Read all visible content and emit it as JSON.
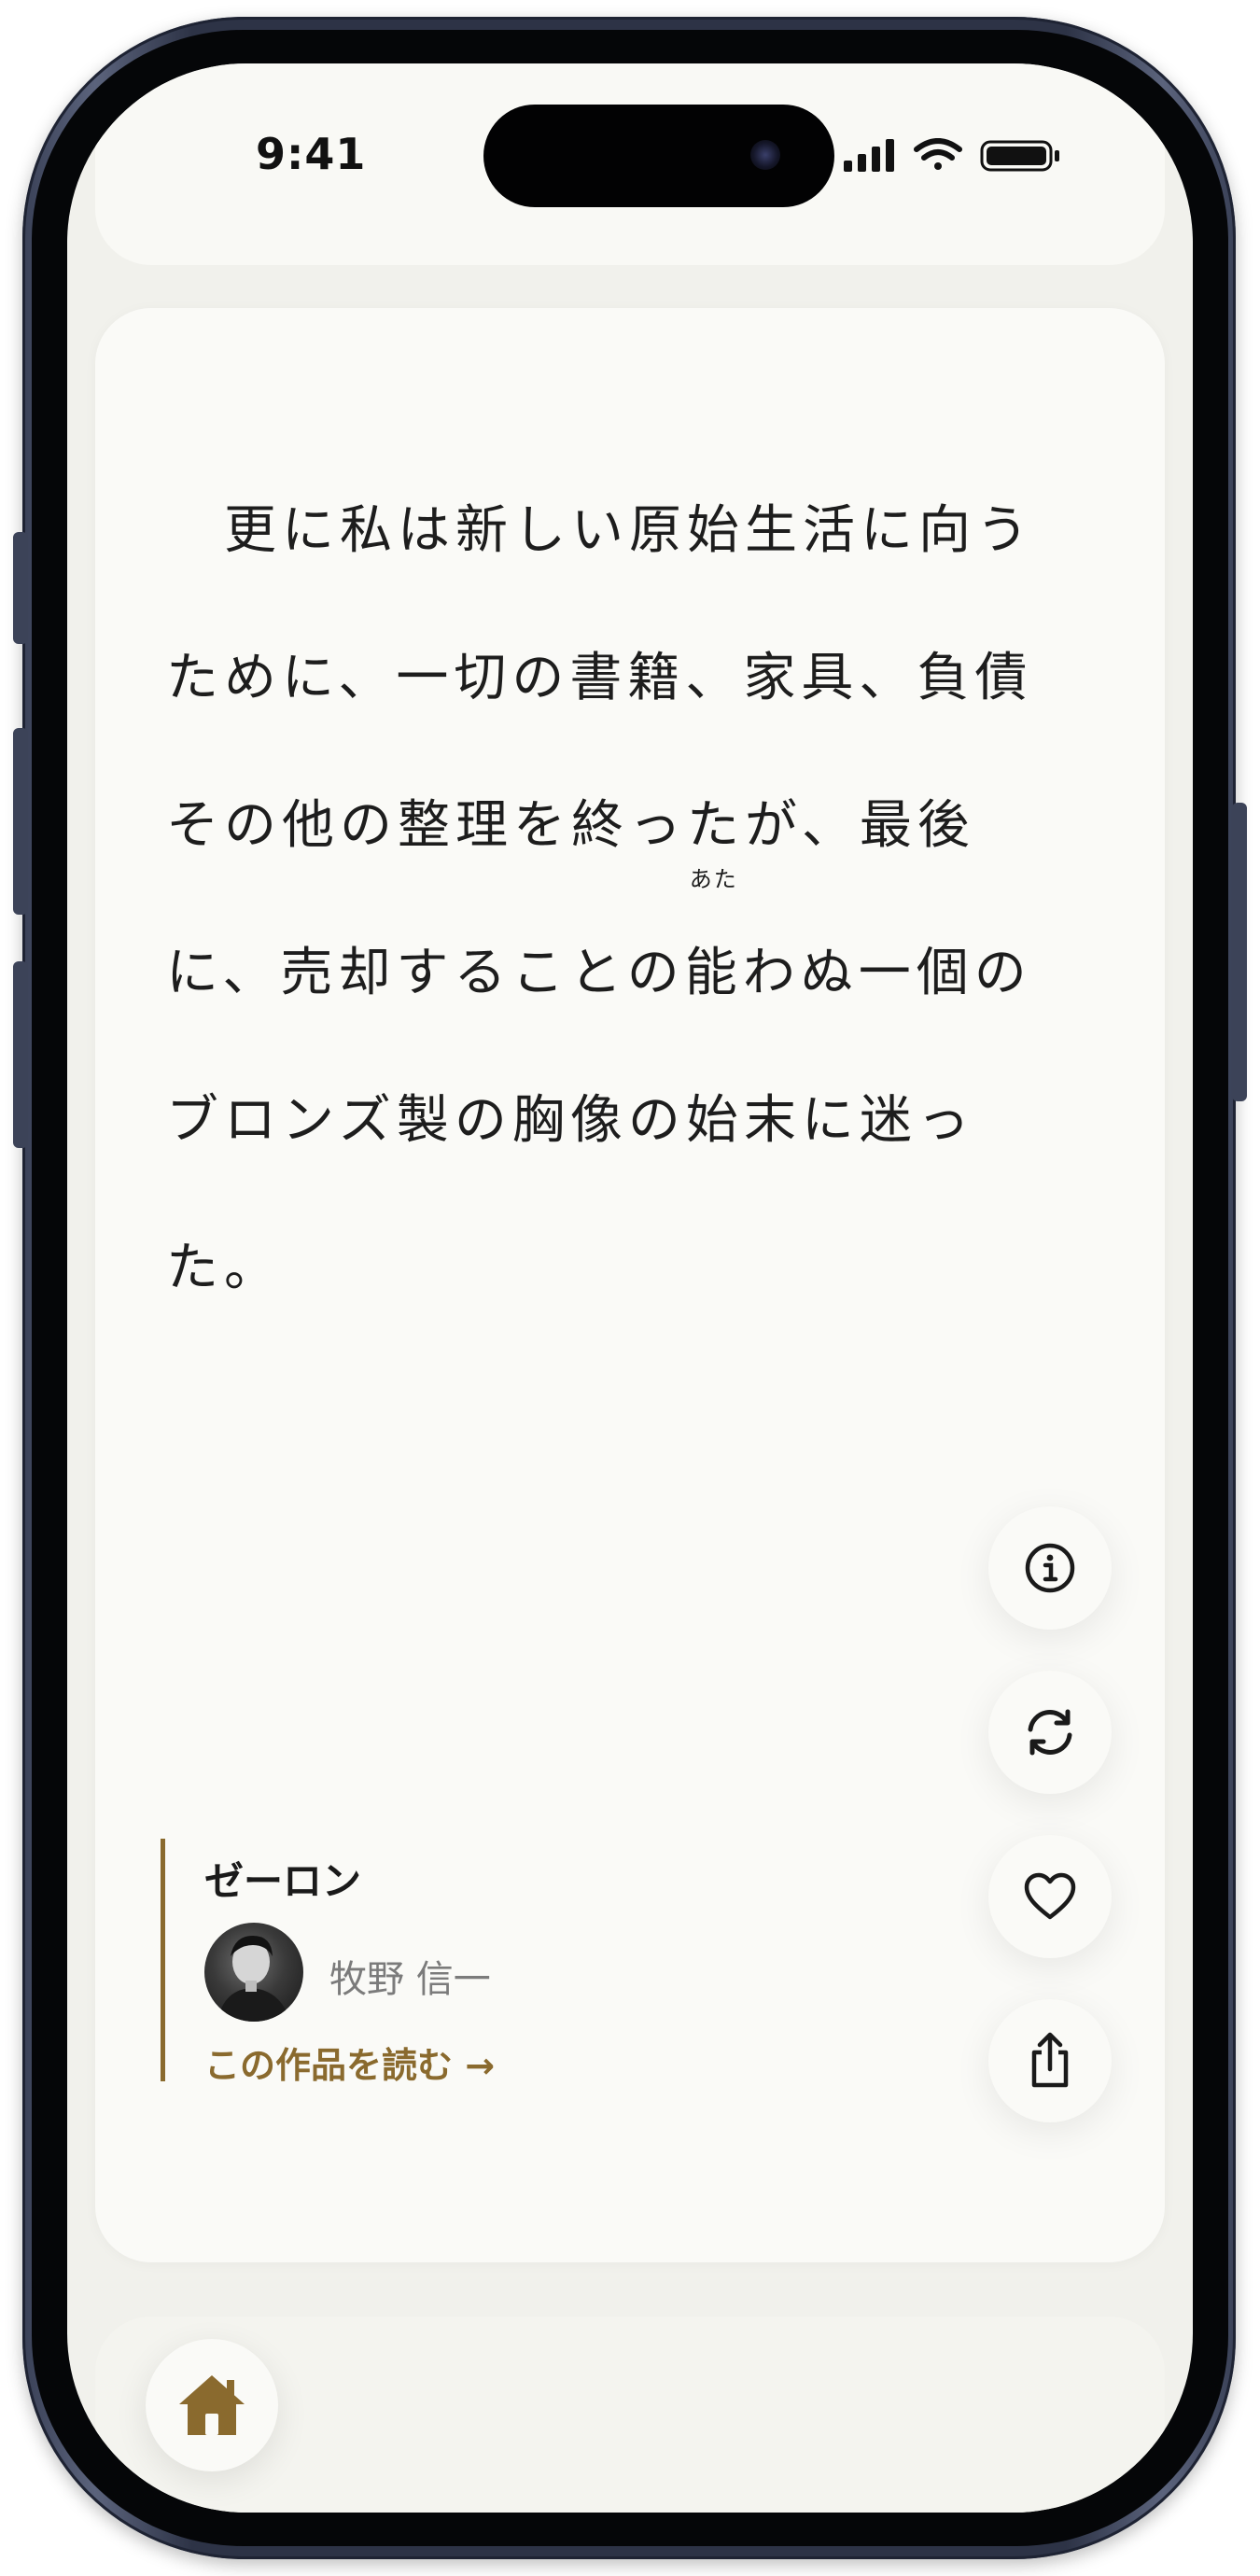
{
  "status_bar": {
    "time": "9:41"
  },
  "quote": {
    "lines": [
      "　更に私は新しい原始生活に向う",
      "ために、一切の書籍、家具、負債",
      "その他の整理を終ったが、最後",
      "に、売却することの",
      "わぬ一個の",
      "ブロンズ製の胸像の始末に迷っ",
      "た。"
    ],
    "ruby_base": "能",
    "ruby_text": "あた"
  },
  "actions": {
    "info": "info-icon",
    "refresh": "refresh-icon",
    "favorite": "heart-icon",
    "share": "share-icon"
  },
  "attribution": {
    "work_title": "ゼーロン",
    "author": "牧野 信一",
    "read_link": "この作品を読む →"
  },
  "accent_color": "#8a6a2e",
  "home": {
    "icon": "home-icon"
  }
}
